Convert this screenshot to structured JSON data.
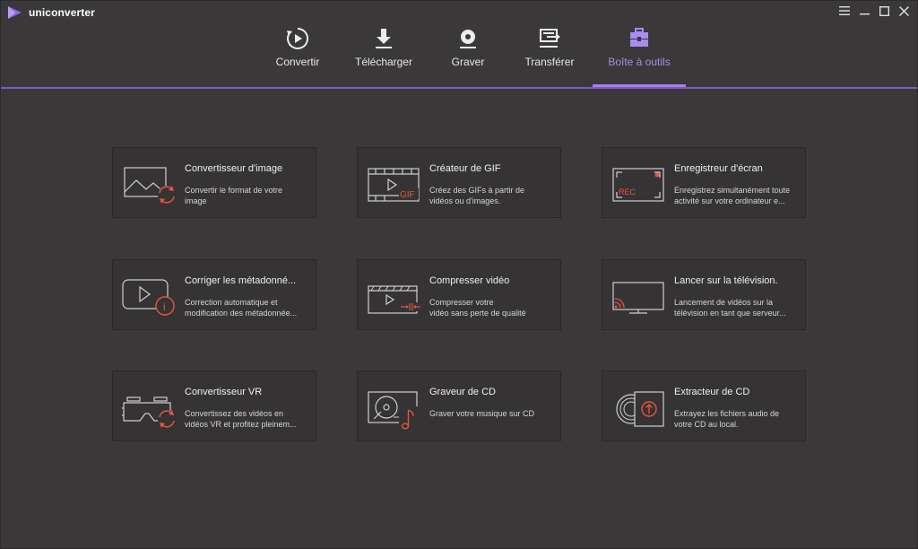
{
  "app": {
    "name": "uniconverter"
  },
  "colors": {
    "accent": "#a37ff5",
    "icon_red": "#e8553f",
    "background": "#3a3838",
    "card": "#353333"
  },
  "nav": {
    "items": [
      {
        "label": "Convertir",
        "icon": "convert-icon"
      },
      {
        "label": "Télécharger",
        "icon": "download-icon"
      },
      {
        "label": "Graver",
        "icon": "burn-icon"
      },
      {
        "label": "Transférer",
        "icon": "transfer-icon"
      },
      {
        "label": "Boîte à outils",
        "icon": "toolbox-icon",
        "active": true
      }
    ]
  },
  "tools": [
    {
      "title": "Convertisseur d'image",
      "desc": [
        "Convertir le format de votre",
        "image"
      ],
      "icon": "image-convert-icon"
    },
    {
      "title": "Créateur de GIF",
      "desc": [
        "Créez des GIFs à partir de",
        "vidéos ou d'images."
      ],
      "icon": "gif-icon",
      "icon_text": "GIF"
    },
    {
      "title": "Enregistreur d'écran",
      "desc": [
        "Enregistrez simultanément toute",
        "activité sur votre ordinateur e..."
      ],
      "icon": "screen-record-icon",
      "icon_text": "REC"
    },
    {
      "title": "Corriger les métadonné...",
      "desc": [
        "Correction automatique et",
        "modification des métadonnée..."
      ],
      "icon": "metadata-icon",
      "icon_text": "i"
    },
    {
      "title": "Compresser vidéo",
      "desc": [
        "Compresser votre",
        "vidéo sans perte de qualité"
      ],
      "icon": "compress-icon"
    },
    {
      "title": "Lancer sur la télévision.",
      "desc": [
        "Lancement de vidéos sur la",
        "télévision en tant que serveur..."
      ],
      "icon": "cast-tv-icon"
    },
    {
      "title": "Convertisseur VR",
      "desc": [
        "Convertissez des vidéos en",
        "vidéos VR et profitez pleinem..."
      ],
      "icon": "vr-icon"
    },
    {
      "title": "Graveur de CD",
      "desc": [
        "Graver votre musique sur CD"
      ],
      "icon": "cd-burner-icon"
    },
    {
      "title": "Extracteur de CD",
      "desc": [
        "Extrayez les fichiers audio de",
        "votre CD au local."
      ],
      "icon": "cd-ripper-icon"
    }
  ]
}
